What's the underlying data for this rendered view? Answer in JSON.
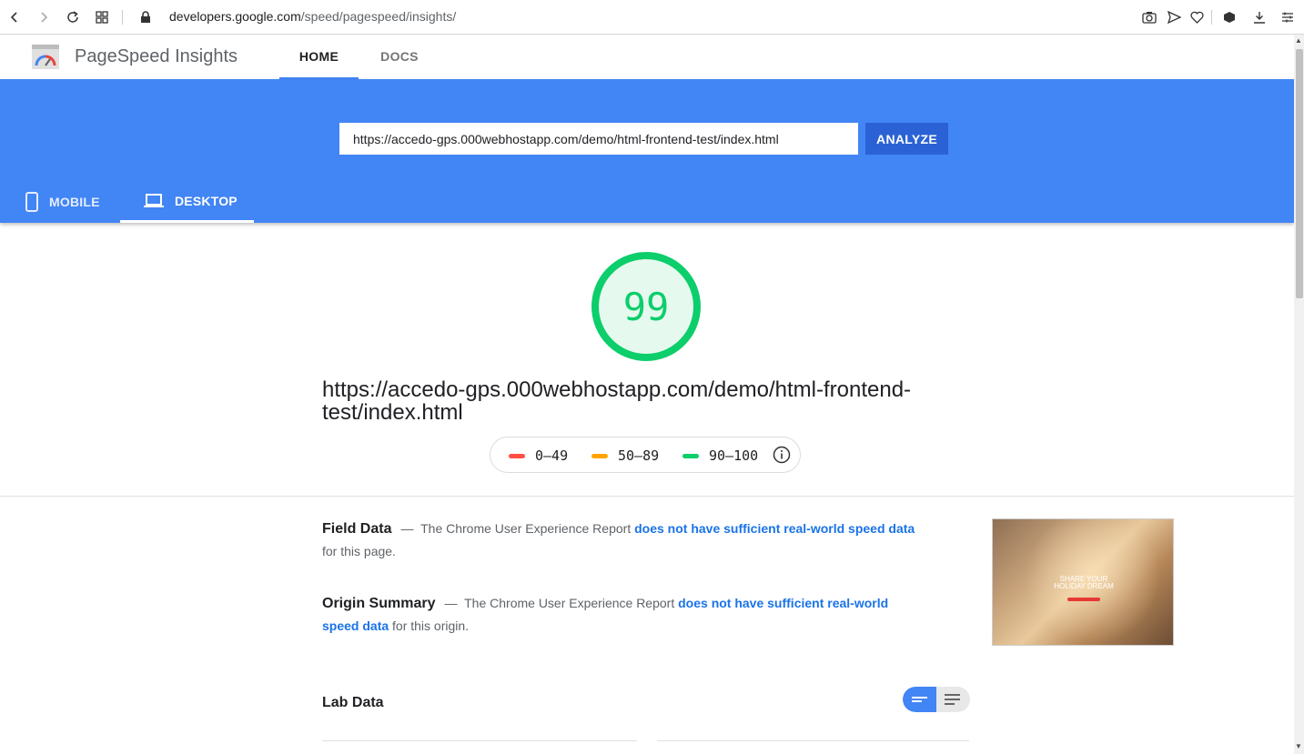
{
  "browser": {
    "address_host": "developers.google.com",
    "address_path": "/speed/pagespeed/insights/"
  },
  "app": {
    "title": "PageSpeed Insights",
    "tabs": [
      "HOME",
      "DOCS"
    ]
  },
  "search": {
    "url_value": "https://accedo-gps.000webhostapp.com/demo/html-frontend-test/index.html",
    "analyze_label": "ANALYZE"
  },
  "device_tabs": {
    "mobile": "MOBILE",
    "desktop": "DESKTOP"
  },
  "score": {
    "value": "99",
    "fraction": 0.99,
    "color": "#0cce6b",
    "page_url": "https://accedo-gps.000webhostapp.com/demo/html-frontend-test/index.html"
  },
  "legend": {
    "fail": "0–49",
    "average": "50–89",
    "pass": "90–100",
    "fail_color": "#ff4e42",
    "average_color": "#ffa400",
    "pass_color": "#0cce6b"
  },
  "field_data": {
    "label": "Field Data",
    "text_before": "The Chrome User Experience Report",
    "link": "does not have sufficient real-world speed data",
    "text_after": "for this page."
  },
  "origin_summary": {
    "label": "Origin Summary",
    "text_before": "The Chrome User Experience Report",
    "link": "does not have sufficient real-world speed data",
    "text_after": "for this origin."
  },
  "thumbnail": {
    "headline_1": "SHARE YOUR",
    "headline_2": "HOLIDAY DREAM"
  },
  "lab_data": {
    "label": "Lab Data"
  }
}
